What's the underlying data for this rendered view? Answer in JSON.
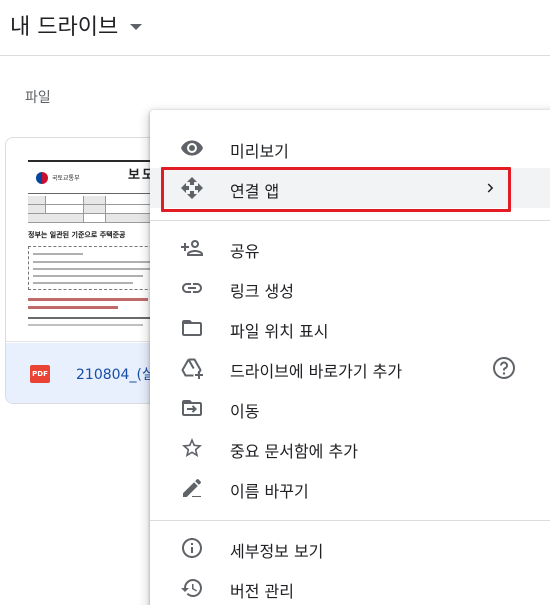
{
  "header": {
    "title": "내 드라이브"
  },
  "section": {
    "label": "파일"
  },
  "file": {
    "name": "210804_(실",
    "type_badge": "PDF",
    "thumbnail": {
      "ministry": "국토교통부",
      "title": "보도",
      "headline": "정부는 일관된 기준으로 주택준공"
    }
  },
  "menu": {
    "items": [
      {
        "label": "미리보기",
        "icon": "eye-icon"
      },
      {
        "label": "연결 앱",
        "icon": "move-arrows-icon"
      },
      {
        "label": "공유",
        "icon": "add-person-icon"
      },
      {
        "label": "링크 생성",
        "icon": "link-icon"
      },
      {
        "label": "파일 위치 표시",
        "icon": "folder-icon"
      },
      {
        "label": "드라이브에 바로가기 추가",
        "icon": "drive-add-shortcut-icon"
      },
      {
        "label": "이동",
        "icon": "move-to-folder-icon"
      },
      {
        "label": "중요 문서함에 추가",
        "icon": "star-icon"
      },
      {
        "label": "이름 바꾸기",
        "icon": "rename-pen-icon"
      },
      {
        "label": "세부정보 보기",
        "icon": "info-icon"
      },
      {
        "label": "버전 관리",
        "icon": "history-icon"
      }
    ]
  },
  "colors": {
    "highlight": "#e21b24",
    "selected_file_bg": "#e8f0fe",
    "file_name": "#174ea6",
    "icon_gray": "#5f6368"
  }
}
